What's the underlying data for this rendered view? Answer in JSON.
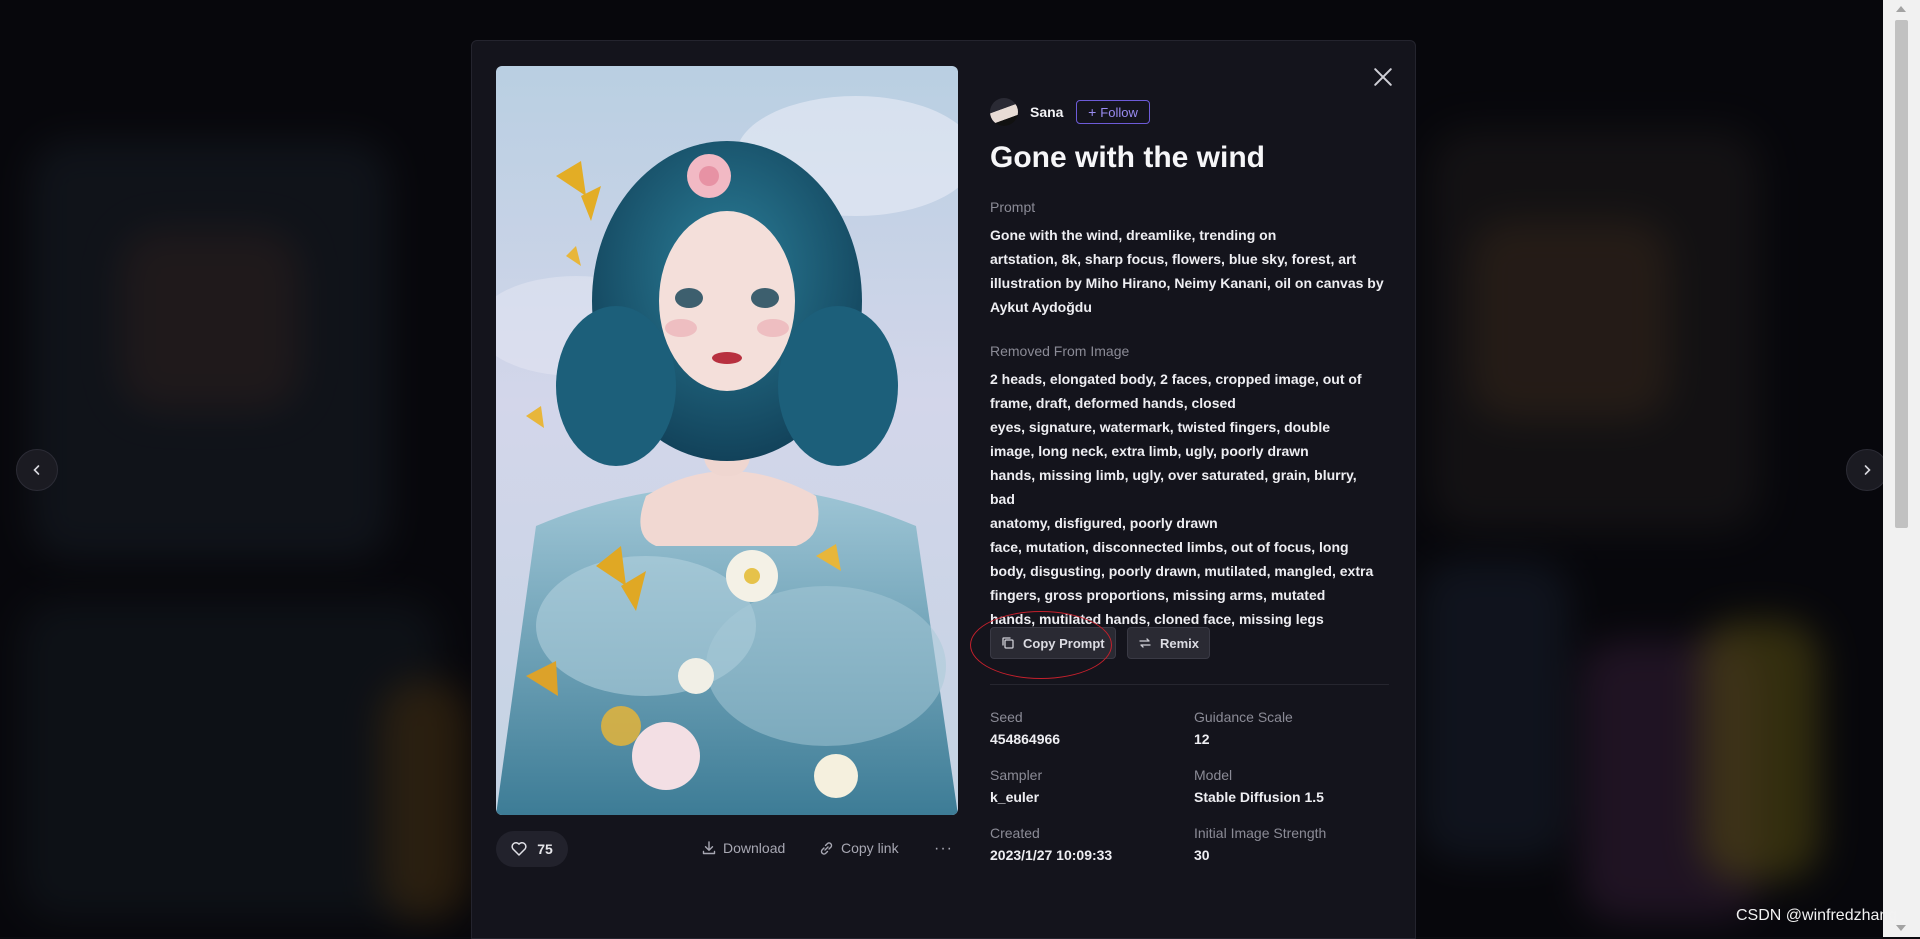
{
  "creator": {
    "name": "Sana",
    "follow_label": "Follow"
  },
  "artwork": {
    "title": "Gone with the wind"
  },
  "prompt": {
    "label": "Prompt",
    "text_lines": [
      "Gone with the wind, dreamlike, trending on",
      "artstation, 8k, sharp focus, flowers, blue sky, forest, art",
      "illustration by Miho Hirano, Neimy Kanani, oil on canvas by",
      "Aykut Aydoğdu"
    ]
  },
  "removed": {
    "label": "Removed From Image",
    "text_lines": [
      "2 heads, elongated body, 2 faces, cropped image, out of",
      "frame, draft, deformed hands, closed",
      "eyes, signature, watermark, twisted fingers, double",
      "image, long neck, extra limb, ugly, poorly drawn",
      "hands, missing limb, ugly, over saturated, grain, blurry, bad",
      "anatomy, disfigured, poorly drawn",
      "face, mutation, disconnected limbs, out of focus, long",
      "body, disgusting, poorly drawn, mutilated, mangled, extra",
      "fingers, gross proportions, missing arms, mutated",
      "hands, mutilated hands, cloned face, missing legs"
    ]
  },
  "buttons": {
    "copy_prompt": "Copy Prompt",
    "remix": "Remix"
  },
  "meta": {
    "seed": {
      "label": "Seed",
      "value": "454864966"
    },
    "guidance_scale": {
      "label": "Guidance Scale",
      "value": "12"
    },
    "sampler": {
      "label": "Sampler",
      "value": "k_euler"
    },
    "model": {
      "label": "Model",
      "value": "Stable Diffusion 1.5"
    },
    "created": {
      "label": "Created",
      "value": "2023/1/27 10:09:33"
    },
    "initial_image_strength": {
      "label": "Initial Image Strength",
      "value": "30"
    }
  },
  "actions": {
    "likes": "75",
    "download": "Download",
    "copy_link": "Copy link",
    "more": "···"
  },
  "icons": {
    "close": "close-icon",
    "like": "heart-icon",
    "download": "download-icon",
    "link": "link-icon",
    "copy": "copy-icon",
    "remix": "remix-icon",
    "prev": "chevron-left-icon",
    "next": "chevron-right-icon"
  },
  "colors": {
    "accent": "#6d5bd8",
    "annotation": "#c4202c",
    "modal_bg": "#14141c"
  },
  "watermark": "CSDN @winfredzhang"
}
